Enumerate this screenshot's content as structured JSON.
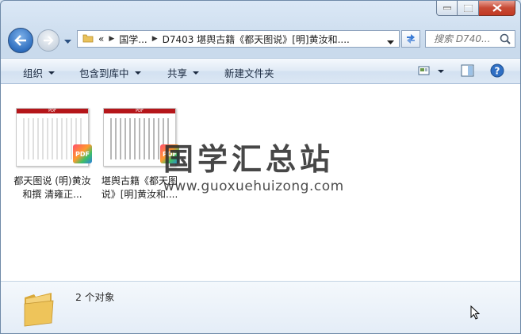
{
  "window": {
    "caption_buttons": [
      "minimize",
      "maximize",
      "close"
    ]
  },
  "address_bar": {
    "breadcrumb_overflow": "«",
    "crumbs": [
      "国学...",
      "D7403 堪舆古籍《都天图说》[明]黄汝和...."
    ]
  },
  "search": {
    "placeholder": "搜索 D740..."
  },
  "toolbar": {
    "organize": "组织",
    "include_in_library": "包含到库中",
    "share": "共享",
    "new_folder": "新建文件夹"
  },
  "files": [
    {
      "label": "都天图说 (明)黄汝和撰 清雍正...",
      "badge": "PDF",
      "thumb_header": "PDF"
    },
    {
      "label": "堪舆古籍《都天图说》[明]黄汝和....",
      "badge": "PDF",
      "thumb_header": "PDF"
    }
  ],
  "watermark": {
    "title": "国学汇总站",
    "url": "www.guoxuehuizong.com"
  },
  "details": {
    "count_text": "2 个对象"
  },
  "colors": {
    "window_frame": "#c9daec",
    "close_button": "#c74a35",
    "pdf_header": "#b5161a"
  }
}
